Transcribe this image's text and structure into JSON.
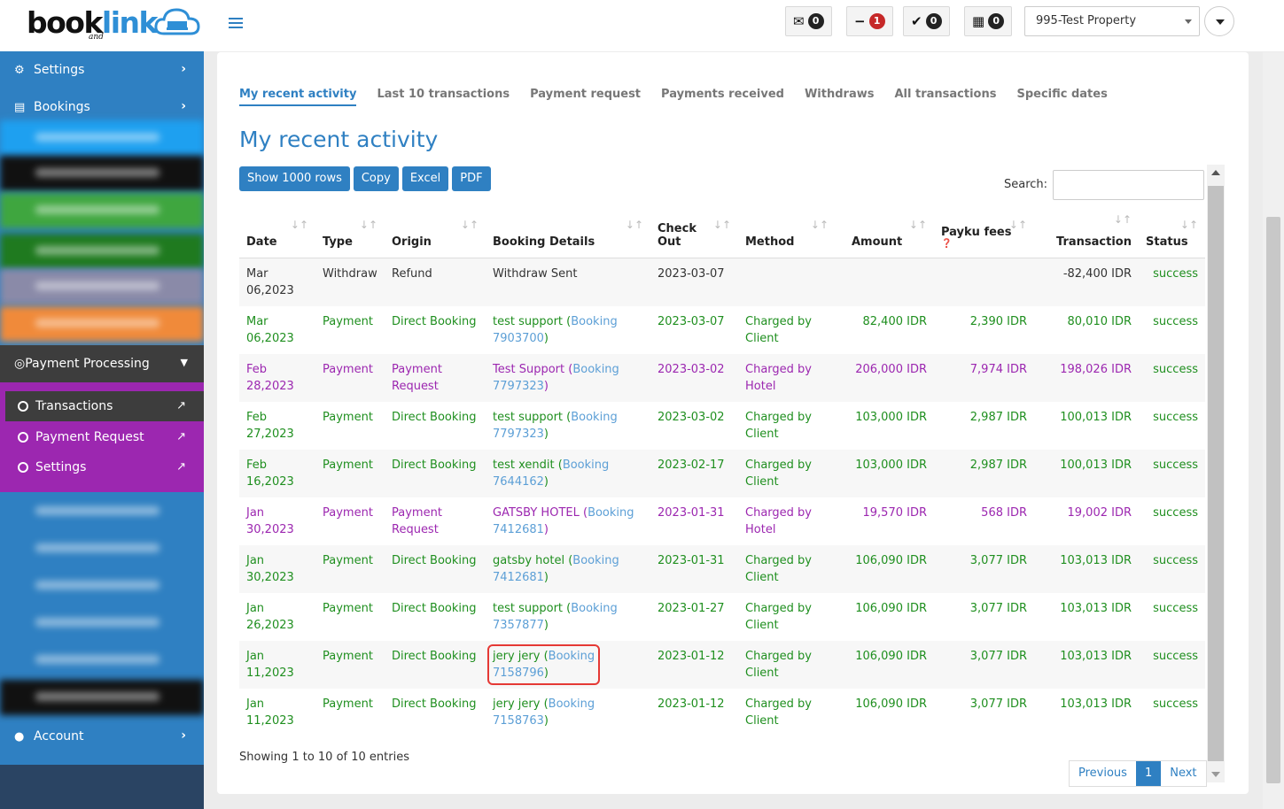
{
  "brand": {
    "word_a": "book",
    "word_b": "link",
    "and": "and"
  },
  "topbar": {
    "badges": [
      {
        "icon": "envelope-icon",
        "glyph": "✉",
        "count": "0",
        "color": "#222222"
      },
      {
        "icon": "minus-icon",
        "glyph": "−",
        "count": "1",
        "color": "#c62828"
      },
      {
        "icon": "check-icon",
        "glyph": "✔",
        "count": "0",
        "color": "#222222"
      },
      {
        "icon": "calendar-icon",
        "glyph": "▦",
        "count": "0",
        "color": "#222222"
      }
    ],
    "property": "995-Test Property"
  },
  "sidebar": {
    "settings": "Settings",
    "bookings": "Bookings",
    "payment_processing": "Payment Processing",
    "sub": {
      "transactions": "Transactions",
      "payment_request": "Payment Request",
      "settings": "Settings"
    },
    "account": "Account"
  },
  "tabs": [
    "My recent activity",
    "Last 10 transactions",
    "Payment request",
    "Payments received",
    "Withdraws",
    "All transactions",
    "Specific dates"
  ],
  "page_title": "My recent activity",
  "buttons": {
    "show_rows": "Show 1000 rows",
    "copy": "Copy",
    "excel": "Excel",
    "pdf": "PDF"
  },
  "search": {
    "label": "Search:",
    "value": ""
  },
  "table": {
    "headers": {
      "date": "Date",
      "type": "Type",
      "origin": "Origin",
      "details": "Booking Details",
      "checkout_a": "Check",
      "checkout_b": "Out",
      "method": "Method",
      "amount": "Amount",
      "fees": "Payku fees",
      "transaction": "Transaction",
      "status": "Status"
    },
    "rows": [
      {
        "tone": "dark",
        "date_a": "Mar",
        "date_b": "06,2023",
        "type": "Withdraw",
        "origin_a": "Refund",
        "origin_b": "",
        "name": "Withdraw Sent",
        "booking": "",
        "booking_id": "",
        "checkout": "2023-03-07",
        "method_a": "",
        "method_b": "",
        "amount": "",
        "fees": "",
        "transaction": "-82,400 IDR",
        "status": "success"
      },
      {
        "tone": "green",
        "date_a": "Mar",
        "date_b": "06,2023",
        "type": "Payment",
        "origin_a": "Direct Booking",
        "origin_b": "",
        "name": "test support",
        "booking": "Booking",
        "booking_id": "7903700",
        "checkout": "2023-03-07",
        "method_a": "Charged by",
        "method_b": "Client",
        "amount": "82,400 IDR",
        "fees": "2,390 IDR",
        "transaction": "80,010 IDR",
        "status": "success"
      },
      {
        "tone": "purple",
        "date_a": "Feb",
        "date_b": "28,2023",
        "type": "Payment",
        "origin_a": "Payment",
        "origin_b": "Request",
        "name": "Test Support",
        "booking": "Booking",
        "booking_id": "7797323",
        "checkout": "2023-03-02",
        "method_a": "Charged by",
        "method_b": "Hotel",
        "amount": "206,000 IDR",
        "fees": "7,974 IDR",
        "transaction": "198,026 IDR",
        "status": "success"
      },
      {
        "tone": "green",
        "date_a": "Feb",
        "date_b": "27,2023",
        "type": "Payment",
        "origin_a": "Direct Booking",
        "origin_b": "",
        "name": "test support",
        "booking": "Booking",
        "booking_id": "7797323",
        "checkout": "2023-03-02",
        "method_a": "Charged by",
        "method_b": "Client",
        "amount": "103,000 IDR",
        "fees": "2,987 IDR",
        "transaction": "100,013 IDR",
        "status": "success"
      },
      {
        "tone": "green",
        "date_a": "Feb",
        "date_b": "16,2023",
        "type": "Payment",
        "origin_a": "Direct Booking",
        "origin_b": "",
        "name": "test xendit",
        "booking": "Booking",
        "booking_id": "7644162",
        "checkout": "2023-02-17",
        "method_a": "Charged by",
        "method_b": "Client",
        "amount": "103,000 IDR",
        "fees": "2,987 IDR",
        "transaction": "100,013 IDR",
        "status": "success"
      },
      {
        "tone": "purple",
        "date_a": "Jan",
        "date_b": "30,2023",
        "type": "Payment",
        "origin_a": "Payment",
        "origin_b": "Request",
        "name": "GATSBY HOTEL",
        "booking": "Booking",
        "booking_id": "7412681",
        "checkout": "2023-01-31",
        "method_a": "Charged by",
        "method_b": "Hotel",
        "amount": "19,570 IDR",
        "fees": "568 IDR",
        "transaction": "19,002 IDR",
        "status": "success"
      },
      {
        "tone": "green",
        "date_a": "Jan",
        "date_b": "30,2023",
        "type": "Payment",
        "origin_a": "Direct Booking",
        "origin_b": "",
        "name": "gatsby hotel",
        "booking": "Booking",
        "booking_id": "7412681",
        "checkout": "2023-01-31",
        "method_a": "Charged by",
        "method_b": "Client",
        "amount": "106,090 IDR",
        "fees": "3,077 IDR",
        "transaction": "103,013 IDR",
        "status": "success"
      },
      {
        "tone": "green",
        "date_a": "Jan",
        "date_b": "26,2023",
        "type": "Payment",
        "origin_a": "Direct Booking",
        "origin_b": "",
        "name": "test support",
        "booking": "Booking",
        "booking_id": "7357877",
        "checkout": "2023-01-27",
        "method_a": "Charged by",
        "method_b": "Client",
        "amount": "106,090 IDR",
        "fees": "3,077 IDR",
        "transaction": "103,013 IDR",
        "status": "success"
      },
      {
        "tone": "green",
        "highlight": true,
        "date_a": "Jan 11,2023",
        "date_b": "",
        "type": "Payment",
        "origin_a": "Direct Booking",
        "origin_b": "",
        "name": "jery jery",
        "booking": "Booking",
        "booking_id": "7158796",
        "checkout": "2023-01-12",
        "method_a": "Charged by",
        "method_b": "Client",
        "amount": "106,090 IDR",
        "fees": "3,077 IDR",
        "transaction": "103,013 IDR",
        "status": "success"
      },
      {
        "tone": "green",
        "date_a": "Jan 11,2023",
        "date_b": "",
        "type": "Payment",
        "origin_a": "Direct Booking",
        "origin_b": "",
        "name": "jery jery",
        "booking": "Booking",
        "booking_id": "7158763",
        "checkout": "2023-01-12",
        "method_a": "Charged by",
        "method_b": "Client",
        "amount": "106,090 IDR",
        "fees": "3,077 IDR",
        "transaction": "103,013 IDR",
        "status": "success"
      }
    ]
  },
  "footer": {
    "showing": "Showing 1 to 10 of 10 entries",
    "previous": "Previous",
    "page": "1",
    "next": "Next"
  },
  "colors": {
    "primary": "#2f80c2",
    "green": "#1f8f1f",
    "purple": "#9c27b0",
    "link": "#5c9fd6",
    "highlight": "#e53935"
  }
}
